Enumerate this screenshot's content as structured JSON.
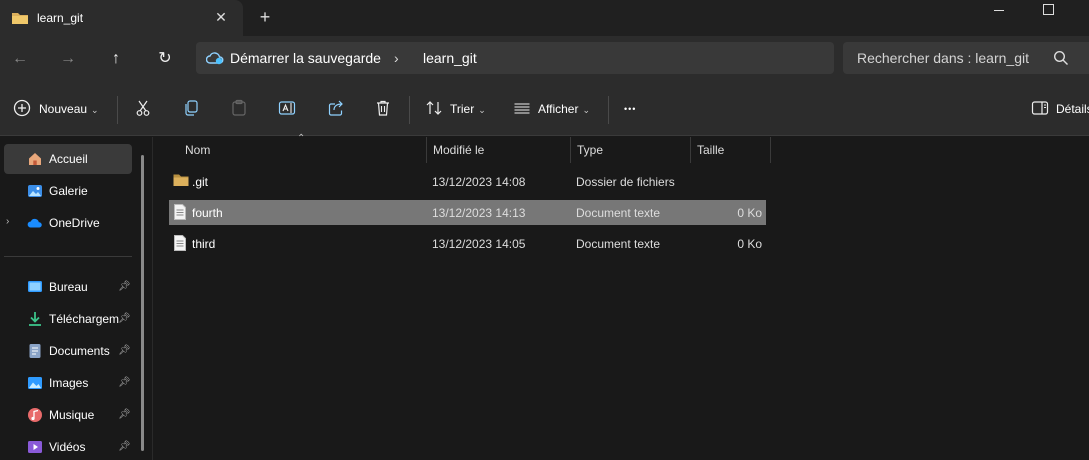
{
  "tab": {
    "title": "learn_git",
    "close_label": "✕",
    "new_tab_label": "+"
  },
  "address": {
    "root": "Démarrer la sauvegarde",
    "separator": "›",
    "current": "learn_git"
  },
  "search": {
    "placeholder": "Rechercher dans : learn_git"
  },
  "toolbar": {
    "new_label": "Nouveau",
    "sort_label": "Trier",
    "view_label": "Afficher",
    "more_label": "•••",
    "details_label": "Détails"
  },
  "sidebar": {
    "items": [
      {
        "label": "Accueil",
        "icon": "home-icon"
      },
      {
        "label": "Galerie",
        "icon": "gallery-icon"
      },
      {
        "label": "OneDrive",
        "icon": "cloud-icon"
      }
    ],
    "pinned": [
      {
        "label": "Bureau",
        "icon": "desktop-icon"
      },
      {
        "label": "Téléchargements",
        "icon": "download-icon"
      },
      {
        "label": "Documents",
        "icon": "documents-icon"
      },
      {
        "label": "Images",
        "icon": "images-icon"
      },
      {
        "label": "Musique",
        "icon": "music-icon"
      },
      {
        "label": "Vidéos",
        "icon": "videos-icon"
      }
    ]
  },
  "columns": {
    "name": "Nom",
    "modified": "Modifié le",
    "type": "Type",
    "size": "Taille"
  },
  "files": [
    {
      "name": ".git",
      "modified": "13/12/2023 14:08",
      "type": "Dossier de fichiers",
      "size": ""
    },
    {
      "name": "fourth",
      "modified": "13/12/2023 14:13",
      "type": "Document texte",
      "size": "0 Ko"
    },
    {
      "name": "third",
      "modified": "13/12/2023 14:05",
      "type": "Document texte",
      "size": "0 Ko"
    }
  ],
  "colors": {
    "folder": "#dcb05c",
    "accent": "#4cc2ff",
    "selection": "#777777"
  }
}
